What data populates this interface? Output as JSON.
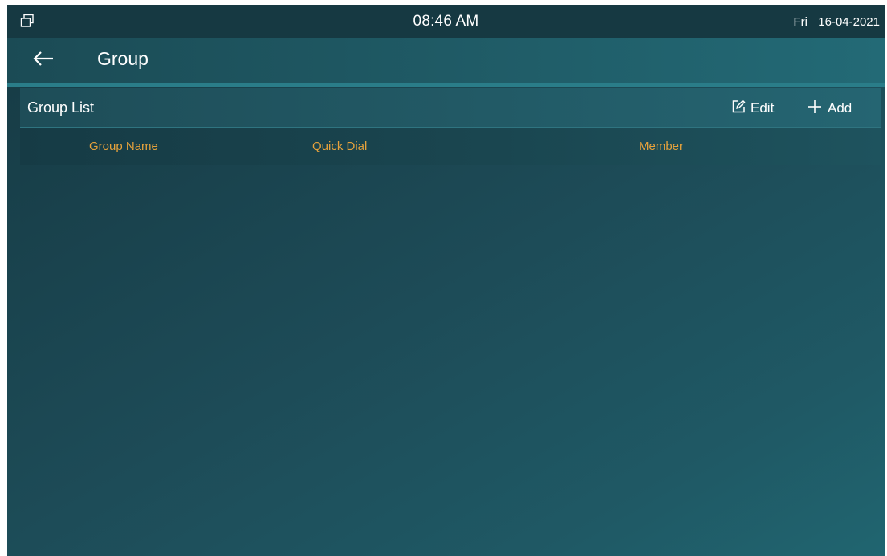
{
  "status_bar": {
    "window_icon": "windows-icon",
    "time": "08:46 AM",
    "day": "Fri",
    "date": "16-04-2021"
  },
  "title_bar": {
    "back_icon": "arrow-left-icon",
    "title": "Group"
  },
  "panel": {
    "title": "Group List",
    "edit": {
      "icon": "edit-icon",
      "label": "Edit"
    },
    "add": {
      "icon": "plus-icon",
      "label": "Add"
    },
    "columns": [
      "Group Name",
      "Quick Dial",
      "Member"
    ],
    "rows": []
  },
  "colors": {
    "background": "#1c4a55",
    "accent_header": "#e6a23c",
    "divider": "#2a7d89",
    "text": "#ffffff"
  }
}
